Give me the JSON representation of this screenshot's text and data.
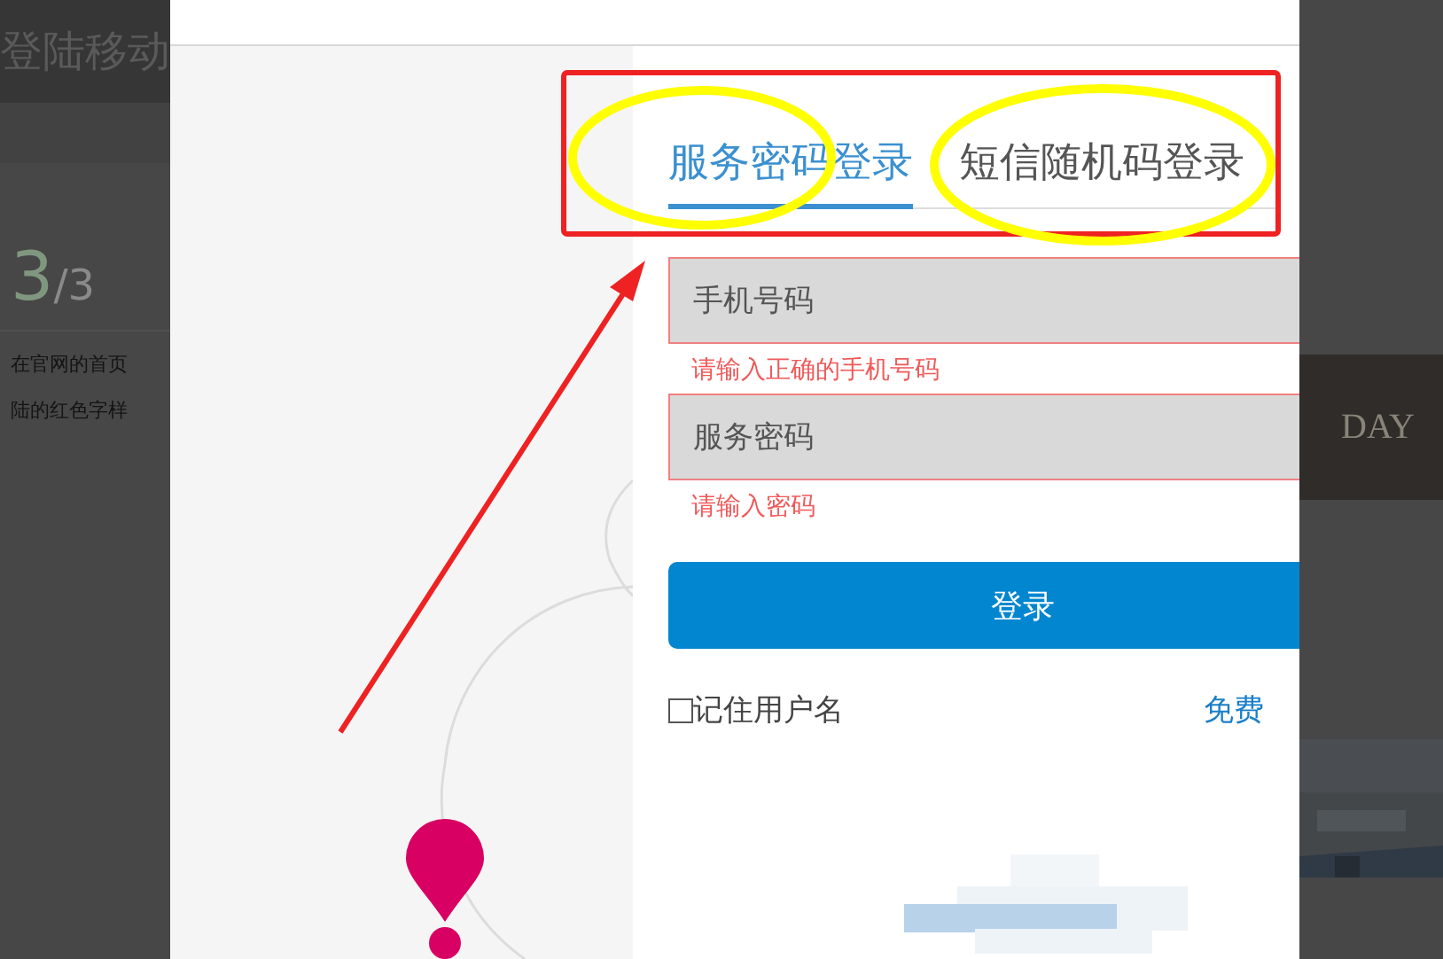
{
  "page": {
    "title": "登陆移动",
    "step": {
      "current": "3",
      "total": "/3"
    },
    "description": [
      "在官网的首页",
      "陆的红色字样"
    ],
    "banner": "DAY"
  },
  "login": {
    "tabs": [
      {
        "label": "服务密码登录",
        "selected": true
      },
      {
        "label": "短信随机码登录",
        "selected": false
      }
    ],
    "fields": [
      {
        "placeholder": "手机号码",
        "error": "请输入正确的手机号码",
        "invalid": true
      },
      {
        "placeholder": "服务密码",
        "error": "请输入密码",
        "invalid": true
      }
    ],
    "submit": "登录",
    "remember": {
      "label": "记住用户名",
      "checked": false
    },
    "register_link": "免费"
  }
}
